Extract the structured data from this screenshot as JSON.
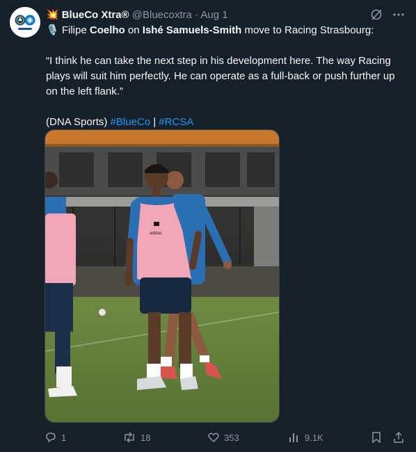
{
  "tweet": {
    "author_name": "BlueCo Xtra®",
    "author_emoji": "💥",
    "handle": "@Bluecoxtra",
    "separator": "·",
    "date": "Aug 1",
    "line1": {
      "mic": "🎙️",
      "p1": " Filipe ",
      "b1": "Coelho",
      "p2": " on ",
      "b2": "Ishé Samuels-Smith",
      "p3": " move to Racing Strasbourg:"
    },
    "quote": "“I think he can take the next step in his development here. The way Racing plays will suit him perfectly. He can operate as a full-back or push further up on the left flank.”",
    "source": "(DNA Sports) ",
    "hashtag1": "#BlueCo",
    "pipe": " | ",
    "hashtag2": "#RCSA",
    "media": {
      "kind": "photo",
      "vest_text": "adidas RACING STRASBOURG"
    }
  },
  "actions": {
    "replies": "1",
    "reposts": "18",
    "likes": "353",
    "views": "9.1K"
  },
  "colors": {
    "background": "#15202b",
    "text": "#f7f9f9",
    "muted": "#8b98a5",
    "link": "#1d9bf0",
    "brand_badge": "#ff3b30"
  },
  "icons": [
    "chelsea-crest-icon",
    "racing-crest-icon",
    "grok-icon",
    "more-icon",
    "reply-icon",
    "repost-icon",
    "like-icon",
    "views-icon",
    "bookmark-icon",
    "share-icon"
  ]
}
